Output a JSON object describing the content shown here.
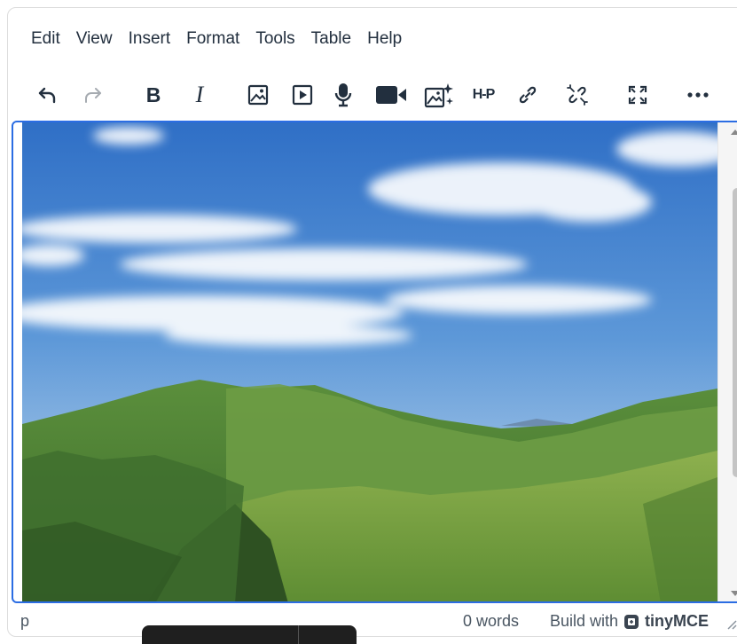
{
  "menubar": {
    "items": [
      {
        "label": "Edit"
      },
      {
        "label": "View"
      },
      {
        "label": "Insert"
      },
      {
        "label": "Format"
      },
      {
        "label": "Tools"
      },
      {
        "label": "Table"
      },
      {
        "label": "Help"
      }
    ]
  },
  "toolbar": {
    "buttons": [
      {
        "icon": "undo-icon"
      },
      {
        "icon": "redo-icon",
        "state": "disabled"
      },
      {
        "icon": "bold-icon",
        "glyph": "B"
      },
      {
        "icon": "italic-icon",
        "glyph": "I"
      },
      {
        "icon": "image-icon"
      },
      {
        "icon": "media-icon"
      },
      {
        "icon": "microphone-icon"
      },
      {
        "icon": "video-camera-icon"
      },
      {
        "icon": "ai-image-icon"
      },
      {
        "icon": "h5p-icon",
        "glyph": "H-P"
      },
      {
        "icon": "link-icon"
      },
      {
        "icon": "unlink-icon"
      },
      {
        "icon": "fullscreen-icon"
      },
      {
        "icon": "more-icon"
      }
    ]
  },
  "statusbar": {
    "path": "p",
    "word_count": "0 words",
    "branding_prefix": "Build with",
    "branding_name": "tinyMCE"
  },
  "colors": {
    "accent": "#2b6de3",
    "text": "#222f3e",
    "tooltip": "#1f1f1f"
  }
}
